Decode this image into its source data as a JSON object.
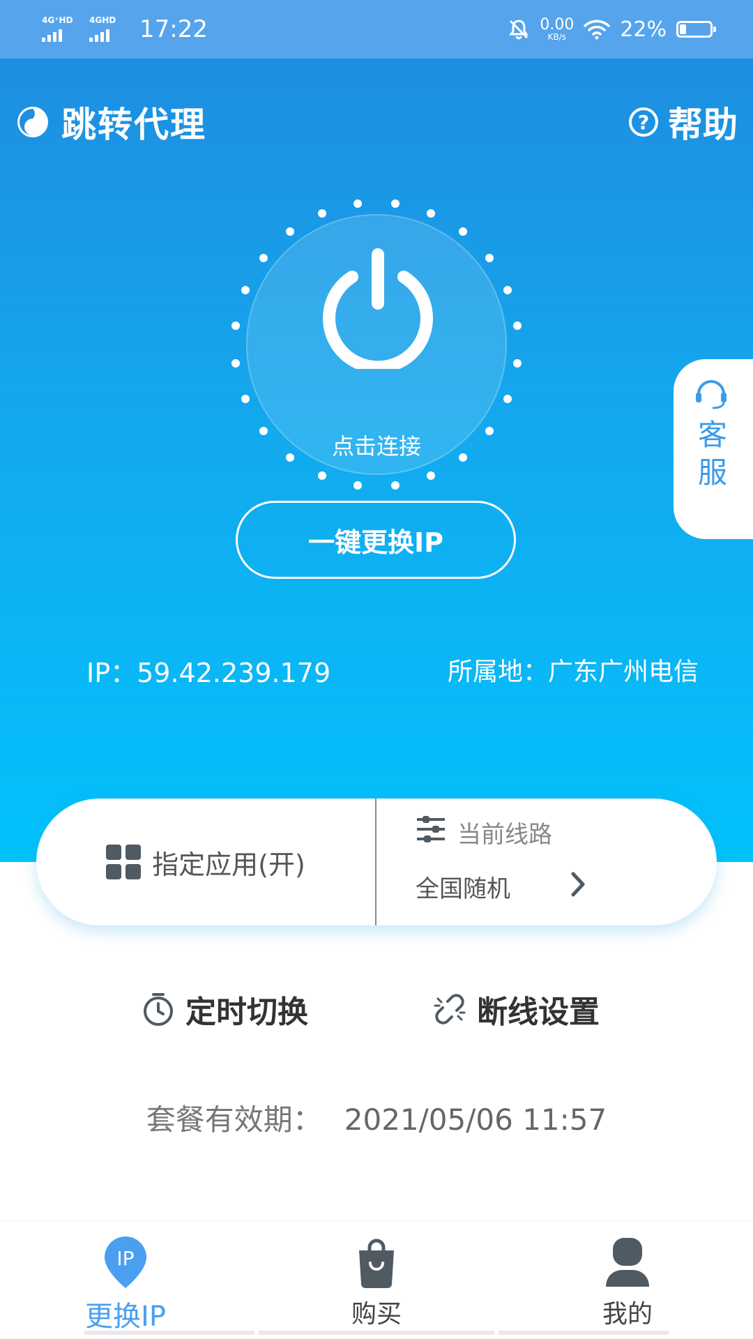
{
  "status_bar": {
    "sim1_label": "4G⁺HD",
    "sim2_label": "4GHD",
    "time": "17:22",
    "net_speed_value": "0.00",
    "net_speed_unit": "KB/s",
    "battery_percent": "22%",
    "battery_level": 0.22
  },
  "header": {
    "app_title": "跳转代理",
    "help_label": "帮助"
  },
  "power": {
    "connect_label": "点击连接"
  },
  "change_ip_button": "一键更换IP",
  "ip_info": {
    "ip_text": "IP：59.42.239.179",
    "location_text": "所属地：广东广州电信"
  },
  "customer_service": {
    "label_line1": "客",
    "label_line2": "服"
  },
  "mode_card": {
    "app_label": "指定应用(开)",
    "route_title": "当前线路",
    "route_value": "全国随机"
  },
  "options": {
    "timer_label": "定时切换",
    "disconnect_label": "断线设置"
  },
  "expiry": {
    "label": "套餐有效期：",
    "value": "2021/05/06 11:57"
  },
  "bottom_nav": {
    "items": [
      {
        "label": "更换IP",
        "icon_text": "IP",
        "active": true
      },
      {
        "label": "购买",
        "active": false
      },
      {
        "label": "我的",
        "active": false
      }
    ]
  },
  "colors": {
    "accent_blue": "#4a9ff0",
    "hero_top": "#1e8ee0",
    "hero_bottom": "#02c2fb",
    "status_bar": "#55a4ec"
  }
}
